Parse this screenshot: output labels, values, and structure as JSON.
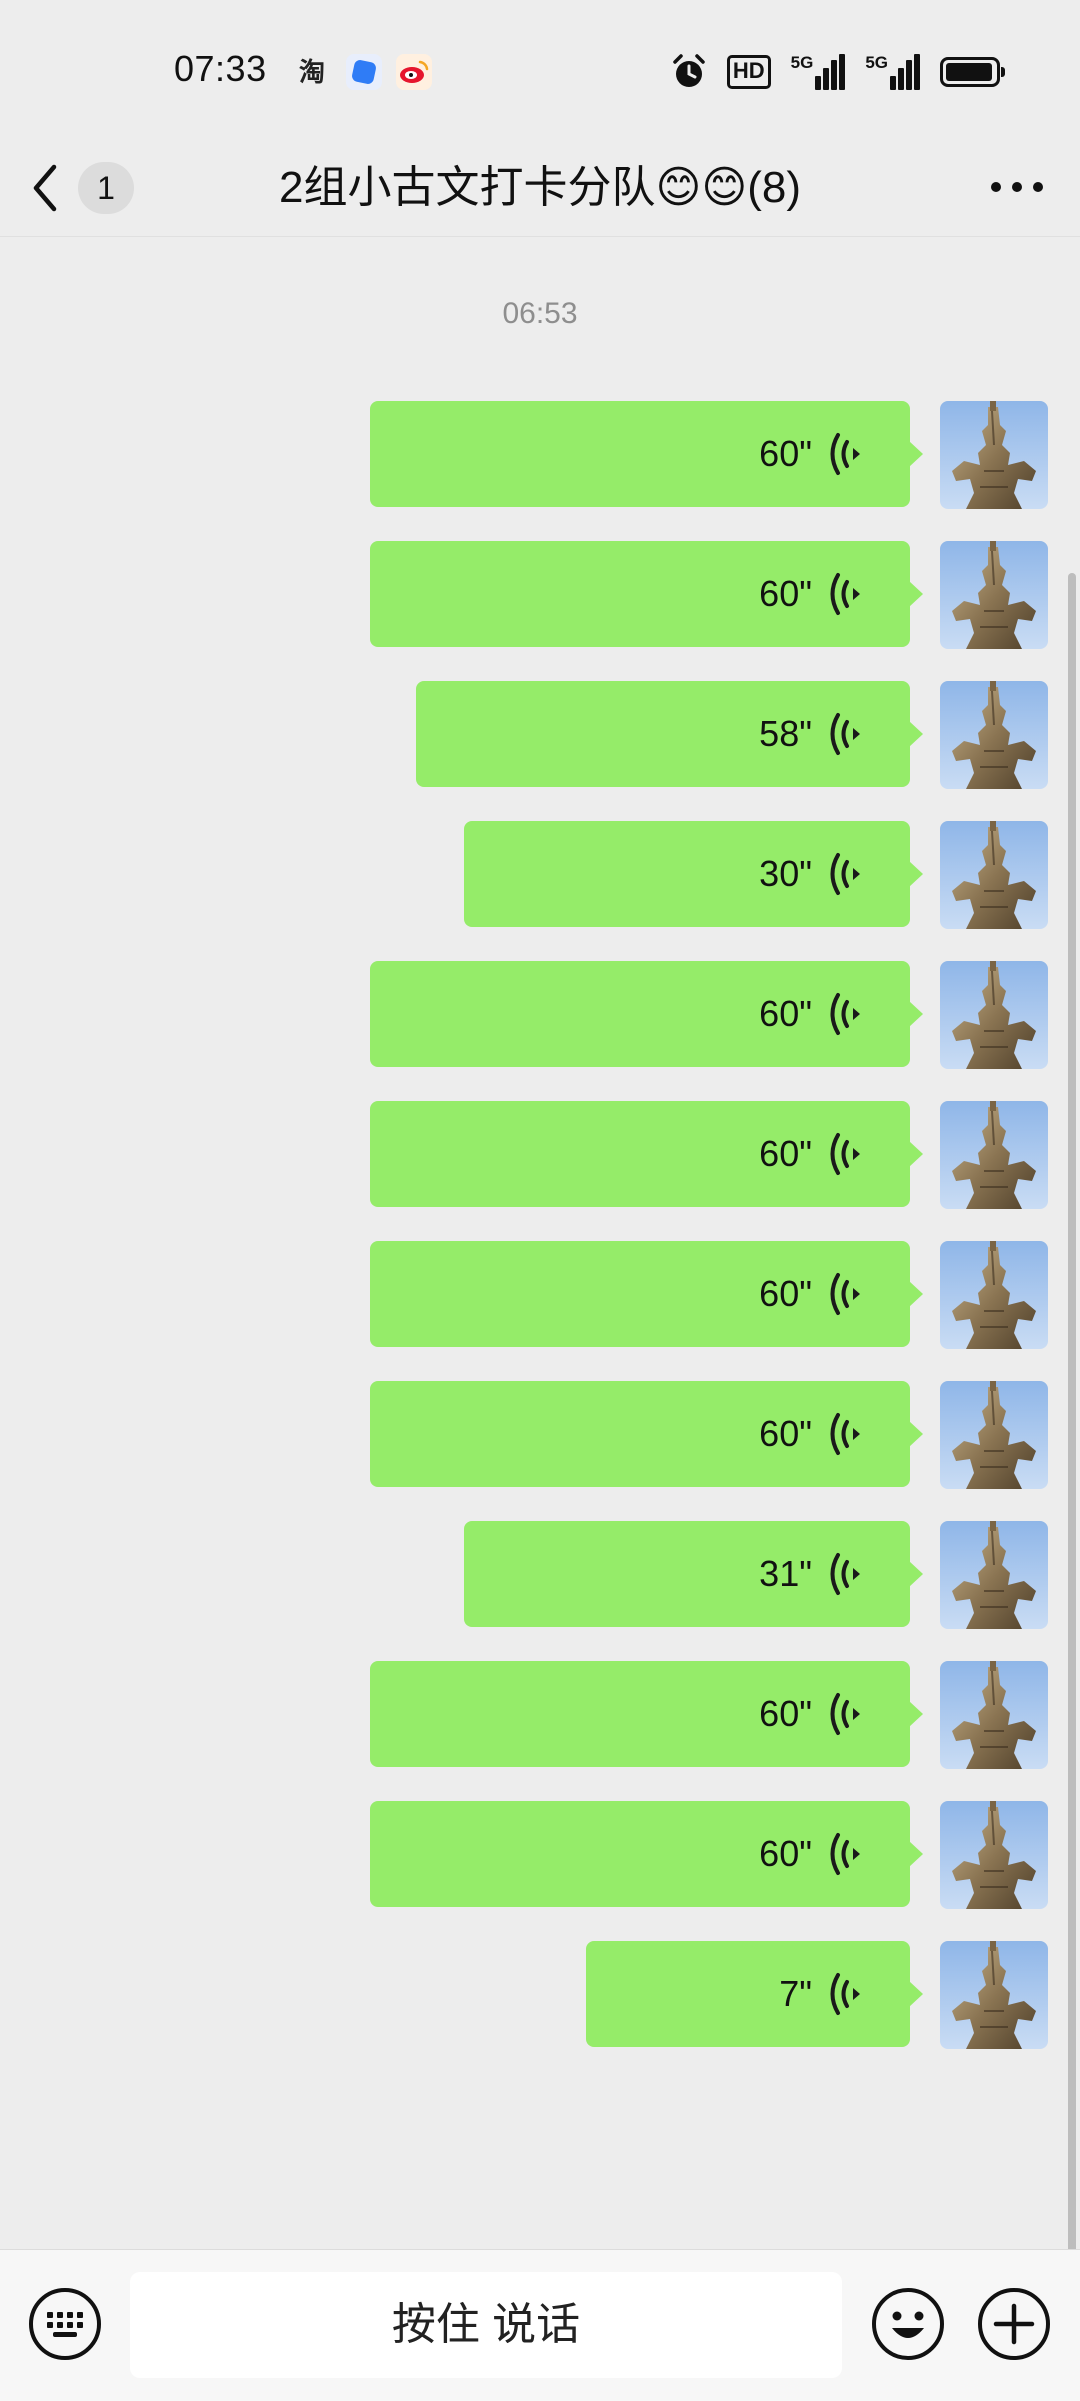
{
  "status_bar": {
    "time": "07:33",
    "app_icons": [
      "taobao-icon",
      "blue-app-icon",
      "weibo-icon"
    ],
    "taobao_glyph": "淘",
    "hd_label": "HD",
    "network_1": "5G",
    "network_2": "5G",
    "battery_percent": 95
  },
  "header": {
    "back_badge_count": "1",
    "title": "2组小古文打卡分队😊😊(8)"
  },
  "chat": {
    "timestamp": "06:53",
    "messages": [
      {
        "duration": "60\""
      },
      {
        "duration": "60\""
      },
      {
        "duration": "58\""
      },
      {
        "duration": "30\""
      },
      {
        "duration": "60\""
      },
      {
        "duration": "60\""
      },
      {
        "duration": "60\""
      },
      {
        "duration": "60\""
      },
      {
        "duration": "31\""
      },
      {
        "duration": "60\""
      },
      {
        "duration": "60\""
      },
      {
        "duration": "7\""
      }
    ]
  },
  "input_bar": {
    "hold_to_talk_label": "按住 说话"
  },
  "colors": {
    "bubble_green": "#95ec69",
    "background": "#ededed",
    "timestamp_gray": "#8e8e8e"
  }
}
